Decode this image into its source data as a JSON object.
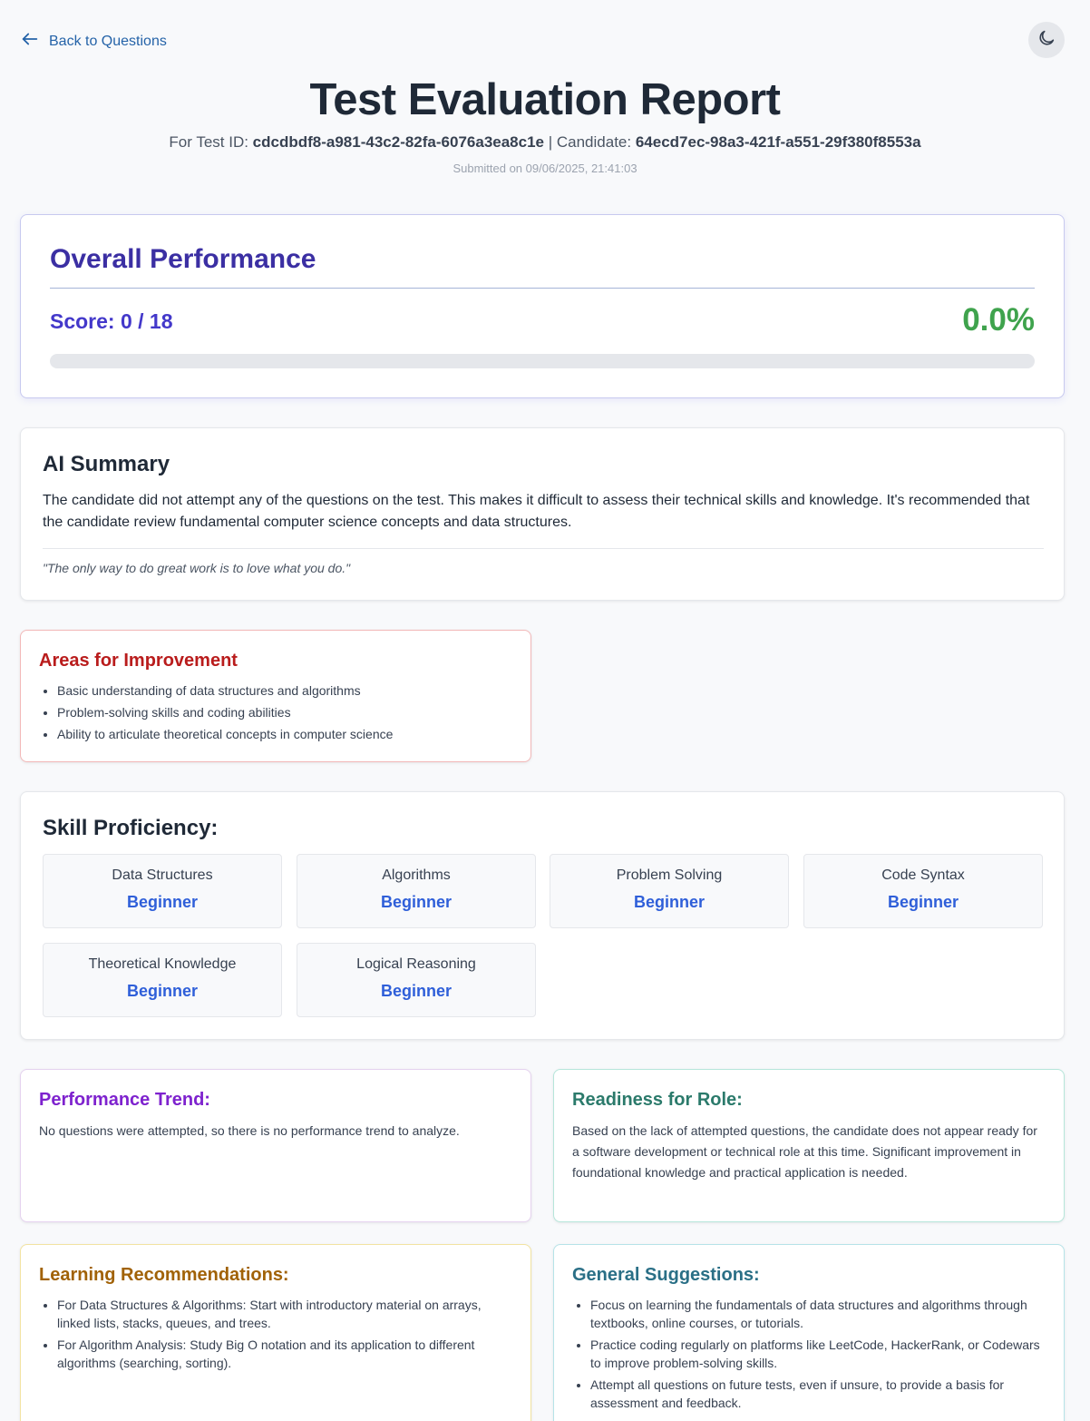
{
  "nav": {
    "back_label": "Back to Questions",
    "theme_icon": "moon-icon"
  },
  "header": {
    "title": "Test Evaluation Report",
    "test_id_prefix": "For Test ID: ",
    "test_id": "cdcdbdf8-a981-43c2-82fa-6076a3ea8c1e",
    "candidate_prefix": " | Candidate: ",
    "candidate_id": "64ecd7ec-98a3-421f-a551-29f380f8553a",
    "submitted": "Submitted on 09/06/2025, 21:41:03"
  },
  "overall": {
    "title": "Overall Performance",
    "score_label": "Score: 0 / 18",
    "percentage": "0.0%",
    "progress_fraction": 0.0
  },
  "summary": {
    "title": "AI Summary",
    "text": "The candidate did not attempt any of the questions on the test. This makes it difficult to assess their technical skills and knowledge. It's recommended that the candidate review fundamental computer science concepts and data structures.",
    "quote": "\"The only way to do great work is to love what you do.\""
  },
  "improvement": {
    "title": "Areas for Improvement",
    "items": [
      "Basic understanding of data structures and algorithms",
      "Problem-solving skills and coding abilities",
      "Ability to articulate theoretical concepts in computer science"
    ]
  },
  "skills": {
    "title": "Skill Proficiency:",
    "items": [
      {
        "name": "Data Structures",
        "level": "Beginner"
      },
      {
        "name": "Algorithms",
        "level": "Beginner"
      },
      {
        "name": "Problem Solving",
        "level": "Beginner"
      },
      {
        "name": "Code Syntax",
        "level": "Beginner"
      },
      {
        "name": "Theoretical Knowledge",
        "level": "Beginner"
      },
      {
        "name": "Logical Reasoning",
        "level": "Beginner"
      }
    ]
  },
  "trend": {
    "title": "Performance Trend:",
    "text": "No questions were attempted, so there is no performance trend to analyze."
  },
  "readiness": {
    "title": "Readiness for Role:",
    "text": "Based on the lack of attempted questions, the candidate does not appear ready for a software development or technical role at this time. Significant improvement in foundational knowledge and practical application is needed."
  },
  "learning": {
    "title": "Learning Recommendations:",
    "items": [
      "For Data Structures & Algorithms: Start with introductory material on arrays, linked lists, stacks, queues, and trees.",
      "For Algorithm Analysis: Study Big O notation and its application to different algorithms (searching, sorting)."
    ]
  },
  "general": {
    "title": "General Suggestions:",
    "items": [
      "Focus on learning the fundamentals of data structures and algorithms through textbooks, online courses, or tutorials.",
      "Practice coding regularly on platforms like LeetCode, HackerRank, or Codewars to improve problem-solving skills.",
      "Attempt all questions on future tests, even if unsure, to provide a basis for assessment and feedback."
    ]
  }
}
